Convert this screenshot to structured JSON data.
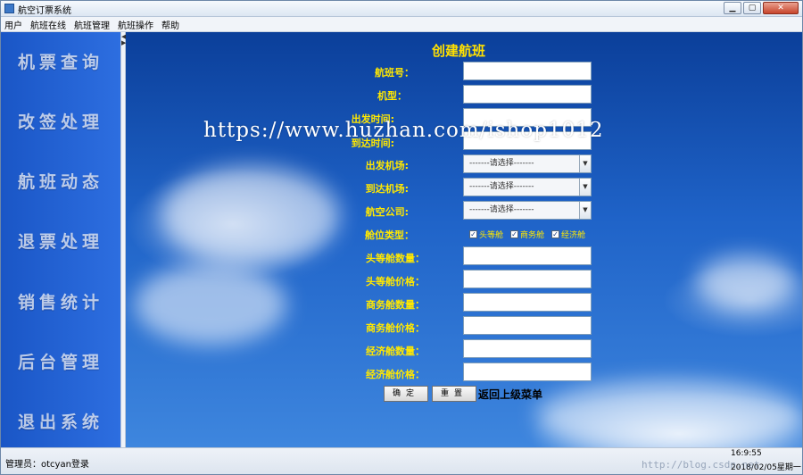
{
  "window": {
    "title": "航空订票系统",
    "buttons": {
      "minimize": "▁",
      "maximize": "▢",
      "close": "✕"
    }
  },
  "menubar": [
    "用户",
    "航班在线",
    "航班管理",
    "航班操作",
    "帮助"
  ],
  "sidebar": {
    "items": [
      "机票查询",
      "改签处理",
      "航班动态",
      "退票处理",
      "销售统计",
      "后台管理",
      "退出系统"
    ]
  },
  "form": {
    "title": "创建航班",
    "flight_no_label": "航班号：",
    "model_label": "机型：",
    "depart_time_label": "出发时间:",
    "arrive_time_label": "到达时间:",
    "depart_airport_label": "出发机场:",
    "arrive_airport_label": "到达机场:",
    "airline_label": "航空公司:",
    "cabin_type_label": "舱位类型：",
    "select_placeholder": "-------请选择-------",
    "cabins": [
      "头等舱",
      "商务舱",
      "经济舱"
    ],
    "first_count_label": "头等舱数量：",
    "first_price_label": "头等舱价格：",
    "business_count_label": "商务舱数量：",
    "business_price_label": "商务舱价格：",
    "economy_count_label": "经济舱数量：",
    "economy_price_label": "经济舱价格：",
    "confirm_label": "确定",
    "reset_label": "重置",
    "back_label": "返回上级菜单"
  },
  "watermark": "https://www.huzhan.com/ishop1012",
  "status": {
    "user": "管理员：otcyan登录",
    "time": "16:9:55",
    "date": "2018/02/05星期一"
  },
  "footer_watermark": "http://blog.csdn.net"
}
